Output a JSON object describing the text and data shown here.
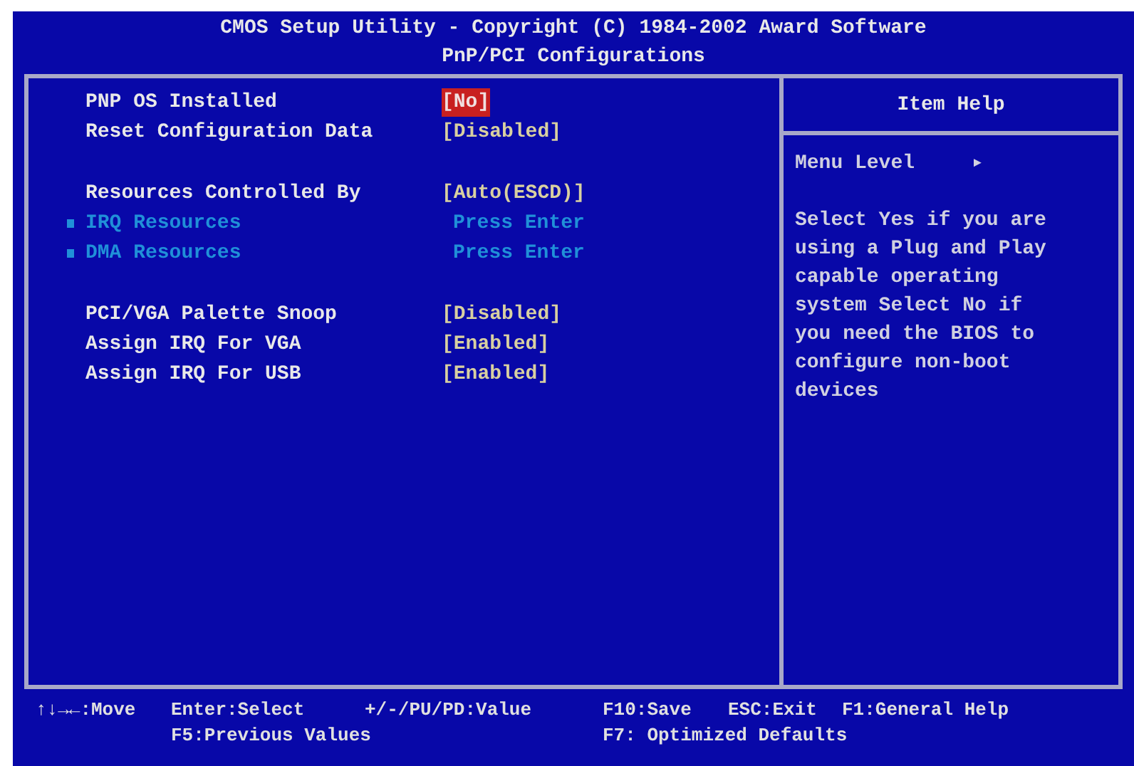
{
  "header": {
    "title": "CMOS Setup Utility - Copyright (C) 1984-2002 Award Software",
    "subtitle": "PnP/PCI Configurations"
  },
  "groups": [
    {
      "items": [
        {
          "kind": "setting",
          "label": "PNP OS Installed",
          "value": "[No]",
          "selected": true
        },
        {
          "kind": "setting",
          "label": "Reset Configuration Data",
          "value": "[Disabled]",
          "selected": false
        }
      ]
    },
    {
      "items": [
        {
          "kind": "setting",
          "label": "Resources Controlled By",
          "value": "[Auto(ESCD)]",
          "selected": false
        },
        {
          "kind": "submenu",
          "label": "IRQ Resources",
          "value": "Press Enter",
          "selected": false
        },
        {
          "kind": "submenu",
          "label": "DMA Resources",
          "value": "Press Enter",
          "selected": false
        }
      ]
    },
    {
      "items": [
        {
          "kind": "setting",
          "label": "PCI/VGA Palette Snoop",
          "value": "[Disabled]",
          "selected": false
        },
        {
          "kind": "setting",
          "label": "Assign IRQ For VGA",
          "value": "[Enabled]",
          "selected": false
        },
        {
          "kind": "setting",
          "label": "Assign IRQ For USB",
          "value": "[Enabled]",
          "selected": false
        }
      ]
    }
  ],
  "help": {
    "title": "Item Help",
    "menu_level_label": "Menu Level",
    "menu_level_value": "▸",
    "text": "Select Yes if you are using a Plug and Play capable operating system Select No if you need the BIOS to configure non-boot devices"
  },
  "footer": {
    "line_1": [
      "↑↓→←:Move",
      "Enter:Select",
      "+/-/PU/PD:Value",
      "F10:Save",
      "ESC:Exit",
      "F1:General Help"
    ],
    "line_2": [
      "F5:Previous Values",
      "F7: Optimized Defaults"
    ]
  }
}
